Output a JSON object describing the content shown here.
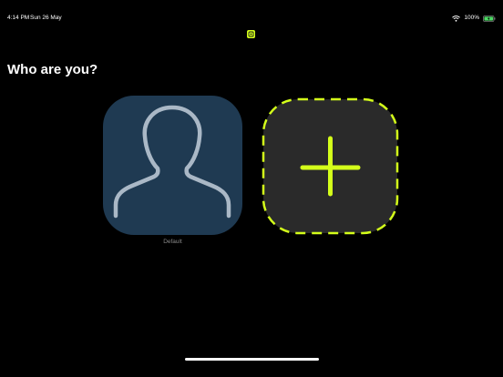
{
  "status_bar": {
    "time": "4:14 PM",
    "date": "Sun 26 May",
    "battery_percent": "100%",
    "wifi_icon": "wifi-icon",
    "battery_icon": "battery-charging-icon"
  },
  "app_badge_icon": "app-badge-icon",
  "page": {
    "title": "Who are you?"
  },
  "profiles": [
    {
      "label": "Default",
      "icon": "user-silhouette-icon"
    }
  ],
  "add_profile": {
    "icon": "plus-icon"
  },
  "colors": {
    "background": "#000000",
    "accent": "#d4ff1a",
    "profile_tile": "#1f3a52",
    "add_tile": "#2a2a2a",
    "silhouette_stroke": "#aab8c6"
  }
}
